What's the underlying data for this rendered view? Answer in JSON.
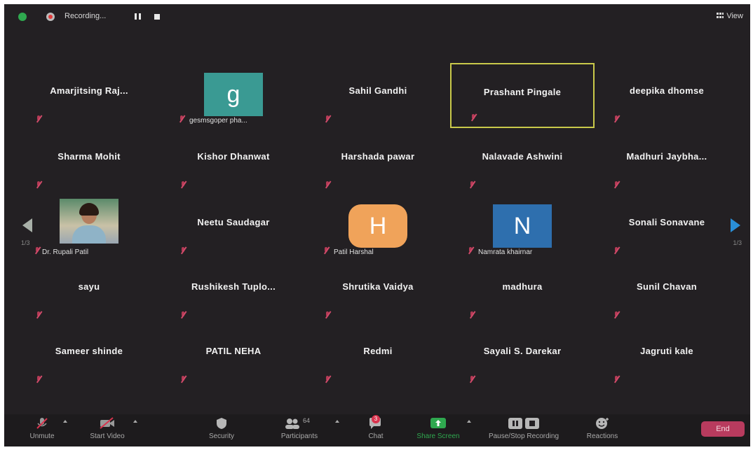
{
  "topbar": {
    "recording_label": "Recording...",
    "view_label": "View"
  },
  "grid": {
    "rows": [
      [
        {
          "name": "Amarjitsing  Raj...",
          "type": "name"
        },
        {
          "name": "gesmsgoper pha...",
          "type": "avatar",
          "letter": "g",
          "color": "#3a9a93"
        },
        {
          "name": "Sahil Gandhi",
          "type": "name"
        },
        {
          "name": "Prashant Pingale",
          "type": "name",
          "active": true
        },
        {
          "name": "deepika dhomse",
          "type": "name"
        }
      ],
      [
        {
          "name": "Sharma Mohit",
          "type": "name"
        },
        {
          "name": "Kishor Dhanwat",
          "type": "name"
        },
        {
          "name": "Harshada pawar",
          "type": "name"
        },
        {
          "name": "Nalavade Ashwini",
          "type": "name"
        },
        {
          "name": "Madhuri  Jaybha...",
          "type": "name"
        }
      ],
      [
        {
          "name": "Dr. Rupali Patil",
          "type": "photo"
        },
        {
          "name": "Neetu Saudagar",
          "type": "name"
        },
        {
          "name": "Patil Harshal",
          "type": "avatar",
          "letter": "H",
          "color": "#f0a35a"
        },
        {
          "name": "Namrata khairnar",
          "type": "avatar",
          "letter": "N",
          "color": "#2e6fae"
        },
        {
          "name": "Sonali Sonavane",
          "type": "name"
        }
      ],
      [
        {
          "name": "sayu",
          "type": "name"
        },
        {
          "name": "Rushikesh  Tuplo...",
          "type": "name"
        },
        {
          "name": "Shrutika Vaidya",
          "type": "name"
        },
        {
          "name": "madhura",
          "type": "name"
        },
        {
          "name": "Sunil Chavan",
          "type": "name"
        }
      ],
      [
        {
          "name": "Sameer shinde",
          "type": "name"
        },
        {
          "name": "PATIL NEHA",
          "type": "name"
        },
        {
          "name": "Redmi",
          "type": "name"
        },
        {
          "name": "Sayali S. Darekar",
          "type": "name"
        },
        {
          "name": "Jagruti kale",
          "type": "name"
        }
      ]
    ],
    "page_left": "1/3",
    "page_right": "1/3"
  },
  "toolbar": {
    "unmute": "Unmute",
    "start_video": "Start Video",
    "security": "Security",
    "participants": "Participants",
    "participants_count": "64",
    "chat": "Chat",
    "chat_badge": "3",
    "share_screen": "Share Screen",
    "pause_stop_recording": "Pause/Stop Recording",
    "reactions": "Reactions",
    "end": "End"
  },
  "colors": {
    "background": "#232023",
    "active_border": "#c9c94a",
    "share_green": "#2fa84f",
    "end_button": "#b83b5e"
  }
}
